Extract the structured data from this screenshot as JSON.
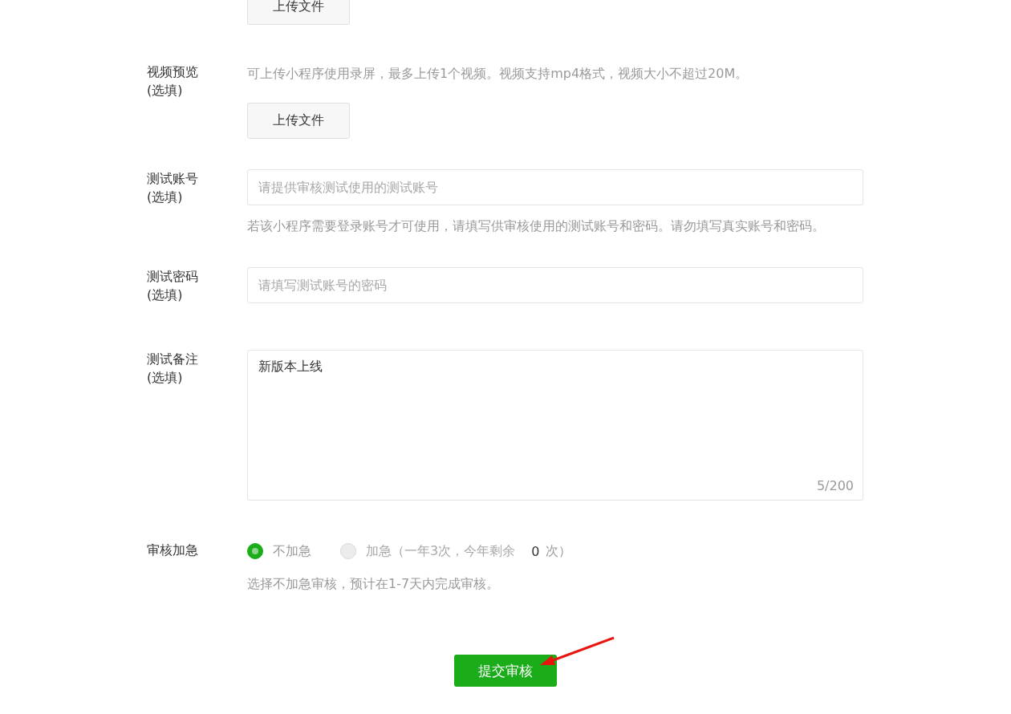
{
  "top_upload_button": "上传文件",
  "video_preview": {
    "label": "视频预览",
    "optional": "(选填)",
    "hint": "可上传小程序使用录屏，最多上传1个视频。视频支持mp4格式，视频大小不超过20M。",
    "button": "上传文件"
  },
  "test_account": {
    "label": "测试账号",
    "optional": "(选填)",
    "placeholder": "请提供审核测试使用的测试账号",
    "hint": "若该小程序需要登录账号才可使用，请填写供审核使用的测试账号和密码。请勿填写真实账号和密码。"
  },
  "test_password": {
    "label": "测试密码",
    "optional": "(选填)",
    "placeholder": "请填写测试账号的密码"
  },
  "test_notes": {
    "label": "测试备注",
    "optional": "(选填)",
    "value": "新版本上线",
    "counter": "5/200"
  },
  "review_speed": {
    "label": "审核加急",
    "options": [
      {
        "label": "不加急",
        "selected": true,
        "disabled": false
      },
      {
        "label": "加急（一年3次，今年剩余",
        "count": "0",
        "suffix": "次）",
        "selected": false,
        "disabled": true
      }
    ],
    "hint": "选择不加急审核，预计在1-7天内完成审核。"
  },
  "submit_button": "提交审核"
}
